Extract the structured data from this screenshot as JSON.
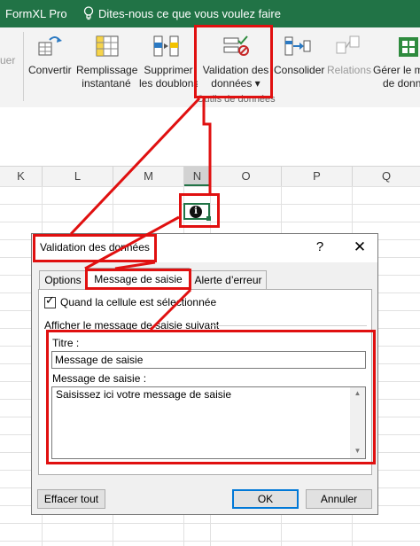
{
  "app": {
    "name": "FormXL Pro",
    "tell_me": "Dites-nous ce que vous voulez faire"
  },
  "ribbon": {
    "partial_left": "uer",
    "buttons": [
      {
        "id": "convertir",
        "label1": "Convertir",
        "label2": ""
      },
      {
        "id": "remplissage",
        "label1": "Remplissage",
        "label2": "instantané"
      },
      {
        "id": "supprimer",
        "label1": "Supprimer",
        "label2": "les doublons"
      },
      {
        "id": "validation",
        "label1": "Validation des",
        "label2": "données ▾"
      },
      {
        "id": "consolider",
        "label1": "Consolider",
        "label2": ""
      },
      {
        "id": "relations",
        "label1": "Relations",
        "label2": ""
      },
      {
        "id": "gerer",
        "label1": "Gérer le m",
        "label2": "de donn"
      }
    ],
    "group_caption": "Outils de données"
  },
  "sheet": {
    "columns": [
      "K",
      "L",
      "M",
      "N",
      "O",
      "P",
      "Q"
    ],
    "cell_icon": "info-icon"
  },
  "dialog": {
    "title": "Validation des données",
    "help": "?",
    "close": "✕",
    "tabs": [
      "Options",
      "Message de saisie",
      "Alerte d’erreur"
    ],
    "active_tab": "Message de saisie",
    "checkbox_label": "Quand la cellule est sélectionnée",
    "checkbox_checked": true,
    "section_label": "Afficher le message de saisie suivant",
    "titre_label": "Titre :",
    "titre_value": "Message de saisie",
    "message_label": "Message de saisie :",
    "message_value": "Saisissez ici votre message de saisie",
    "buttons": {
      "clear": "Effacer tout",
      "ok": "OK",
      "cancel": "Annuler"
    }
  },
  "colors": {
    "excel_green": "#217346",
    "annotation_red": "#e01010",
    "focus_blue": "#0078d7"
  }
}
